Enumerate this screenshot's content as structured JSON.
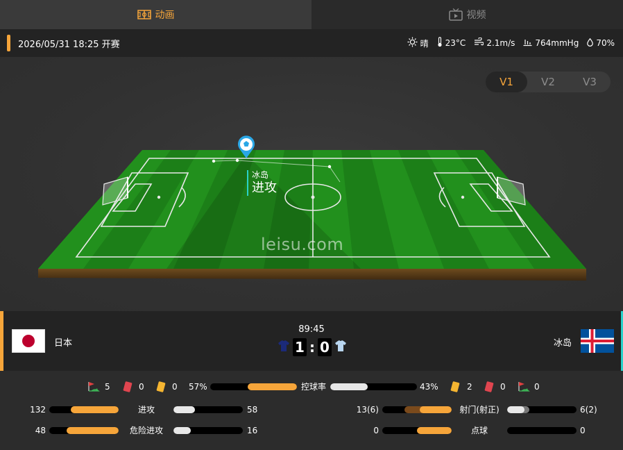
{
  "tabs": [
    {
      "label": "动画",
      "icon": "pitch-icon",
      "active": true
    },
    {
      "label": "视频",
      "icon": "tv-icon",
      "active": false
    }
  ],
  "match_info": {
    "datetime": "2026/05/31 18:25 开赛",
    "weather": "晴",
    "temperature": "23°C",
    "wind": "2.1m/s",
    "pressure": "764mmHg",
    "humidity": "70%"
  },
  "view_switch": [
    "V1",
    "V2",
    "V3"
  ],
  "view_selected": "V1",
  "event": {
    "team": "冰岛",
    "action": "进攻"
  },
  "watermark": "leisu.com",
  "score": {
    "clock": "89:45",
    "home_name": "日本",
    "away_name": "冰岛",
    "home_score": "1",
    "away_score": "0"
  },
  "summary": {
    "home_corners": "5",
    "home_red": "0",
    "home_yellow": "0",
    "home_possession": "57%",
    "possession_label": "控球率",
    "away_possession": "43%",
    "away_yellow": "2",
    "away_red": "0",
    "away_corners": "0",
    "possession_home_frac": 0.57
  },
  "stats_left": [
    {
      "label": "进攻",
      "home": "132",
      "away": "58",
      "home_frac": 0.69,
      "away_frac": 0.31
    },
    {
      "label": "危险进攻",
      "home": "48",
      "away": "16",
      "home_frac": 0.75,
      "away_frac": 0.25
    }
  ],
  "stats_right": [
    {
      "label": "射门(射正)",
      "home": "13(6)",
      "away": "6(2)",
      "home_frac": 0.68,
      "home_inner_frac": 0.46,
      "away_frac": 0.32,
      "away_inner_frac": 0.25
    },
    {
      "label": "点球",
      "home": "0",
      "away": "0",
      "home_frac": 0.5,
      "away_frac": 0.0
    }
  ],
  "colors": {
    "accent": "#f6a53a",
    "away_accent": "#2ad1c9",
    "pitch": "#1f8a1a",
    "japan_red": "#bc002d",
    "iceland_blue": "#02529c",
    "iceland_red": "#dc1e35"
  }
}
